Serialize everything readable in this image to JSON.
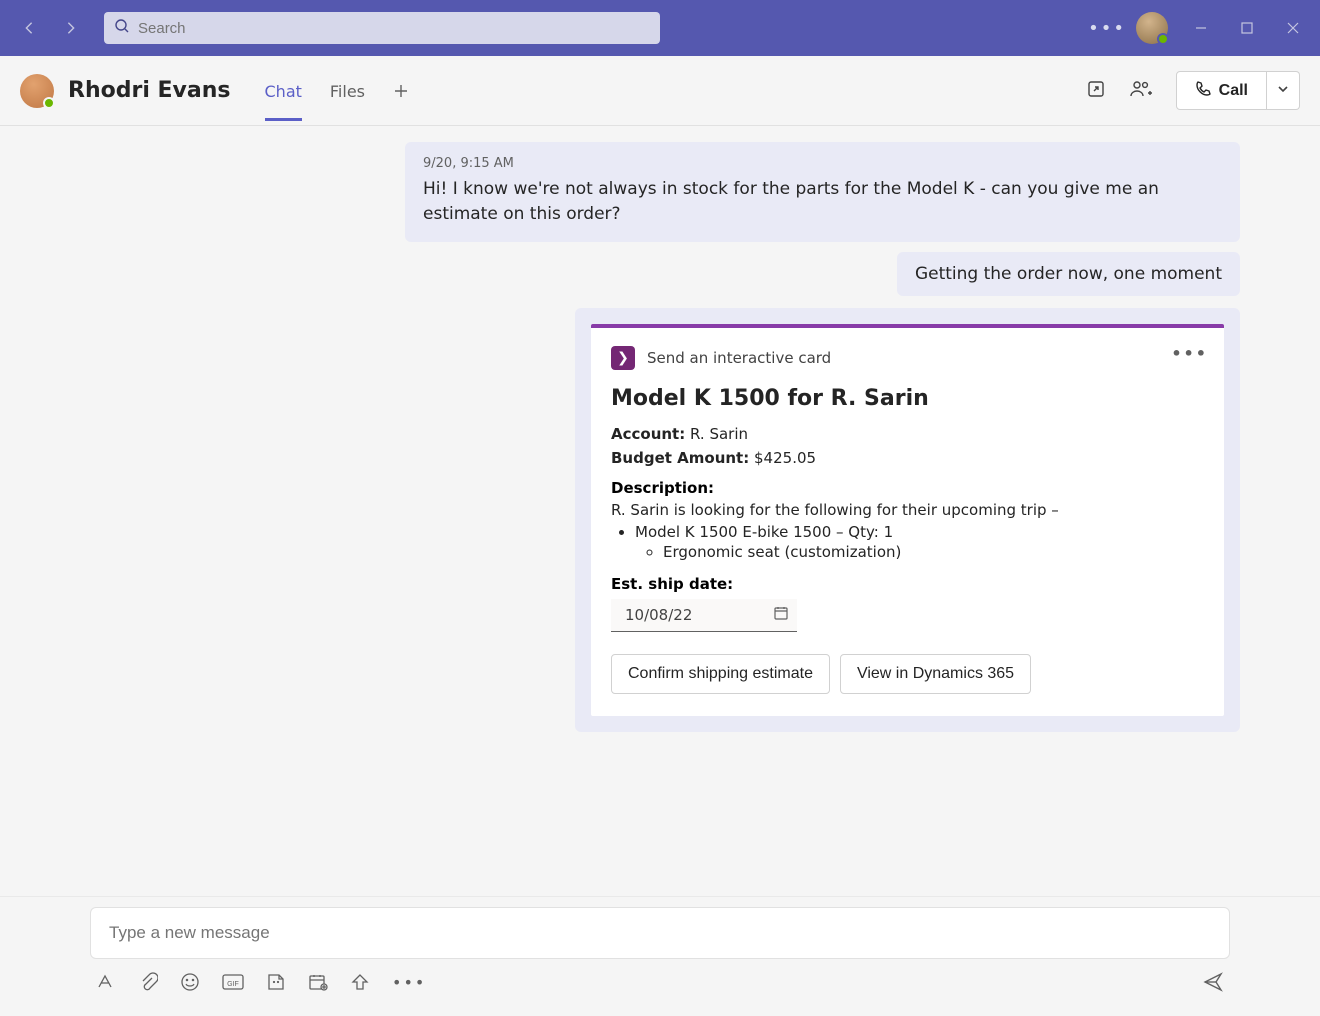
{
  "titlebar": {
    "search_placeholder": "Search"
  },
  "chat": {
    "name": "Rhodri Evans",
    "tabs": [
      "Chat",
      "Files"
    ]
  },
  "header_actions": {
    "call_label": "Call"
  },
  "messages": {
    "incoming": {
      "timestamp": "9/20, 9:15 AM",
      "text": "Hi! I know we're not always in stock for the parts for the Model K - can you give me an estimate on this order?"
    },
    "outgoing_text": "Getting the order now, one moment"
  },
  "card": {
    "source_label": "Send an interactive card",
    "title": "Model K 1500 for R. Sarin",
    "account_label": "Account:",
    "account_value": "R. Sarin",
    "budget_label": "Budget Amount:",
    "budget_value": "$425.05",
    "description_label": "Description:",
    "description_text": "R. Sarin is looking for the following for their upcoming trip –",
    "items": [
      "Model K 1500 E-bike 1500 – Qty: 1"
    ],
    "subitems": [
      "Ergonomic seat (customization)"
    ],
    "ship_label": "Est. ship date:",
    "ship_value": "10/08/22",
    "btn_confirm": "Confirm shipping estimate",
    "btn_view": "View in Dynamics 365"
  },
  "composer": {
    "placeholder": "Type a new message"
  }
}
